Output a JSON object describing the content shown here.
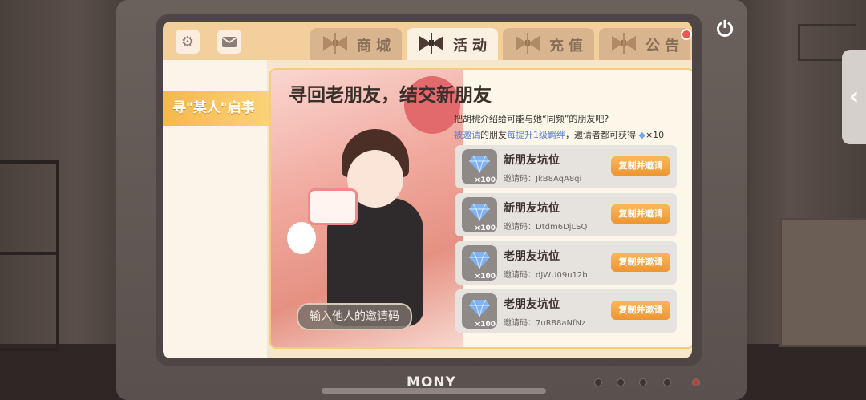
{
  "monitor": {
    "brand": "MONY"
  },
  "tabs": [
    {
      "label": "商城",
      "active": false
    },
    {
      "label": "活动",
      "active": true
    },
    {
      "label": "充值",
      "active": false
    },
    {
      "label": "公告",
      "active": false
    }
  ],
  "sidebar": {
    "items": [
      {
        "label": "寻\"某人\"启事",
        "active": true
      }
    ]
  },
  "panel": {
    "title": "寻回老朋友，结交新朋友",
    "desc_line1": "把胡桃介绍给可能与她“同频”的朋友吧?",
    "desc_line2_a": "被邀请",
    "desc_line2_b": "的朋友",
    "desc_line2_c": "每提升1级羁绊",
    "desc_line2_d": "，邀请者都可获得",
    "desc_line2_reward": "×10",
    "invite_button": "输入他人的邀请码",
    "rows": [
      {
        "title": "新朋友坑位",
        "code_label": "邀请码：",
        "code": "JkB8AqA8qi",
        "reward": "×100",
        "button": "复制并邀请"
      },
      {
        "title": "新朋友坑位",
        "code_label": "邀请码：",
        "code": "Dtdm6DjLSQ",
        "reward": "×100",
        "button": "复制并邀请"
      },
      {
        "title": "老朋友坑位",
        "code_label": "邀请码：",
        "code": "dJWU09u12b",
        "reward": "×100",
        "button": "复制并邀请"
      },
      {
        "title": "老朋友坑位",
        "code_label": "邀请码：",
        "code": "7uR88aNfNz",
        "reward": "×100",
        "button": "复制并邀请"
      }
    ]
  },
  "icons": {
    "settings": "gear-icon",
    "mail": "mail-icon",
    "power": "power-icon",
    "back": "chevron-left-icon",
    "gem": "diamond-icon"
  },
  "colors": {
    "accent_orange": "#ee9532",
    "sidebar_active": "#f6b84a",
    "panel_border": "#f4cd7a",
    "topbar": "#f3cf9b",
    "highlight_blue": "#5b7bd8"
  }
}
